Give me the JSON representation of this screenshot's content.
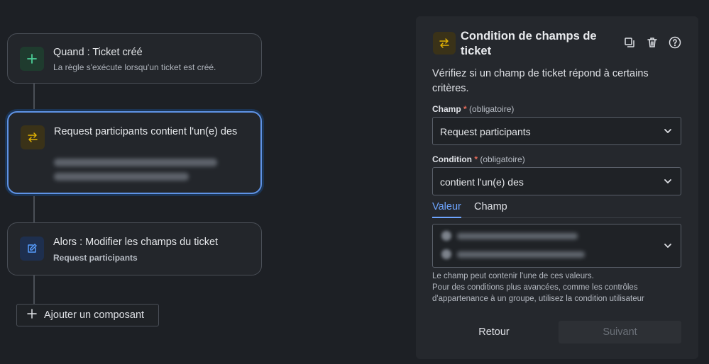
{
  "flow": {
    "trigger": {
      "title": "Quand : Ticket créé",
      "subtitle": "La règle s'exécute lorsqu'un ticket est créé.",
      "icon": "plus-icon"
    },
    "condition": {
      "title": "Request participants contient l'un(e) des",
      "icon": "swap-arrows-icon"
    },
    "action": {
      "title": "Alors : Modifier les champs du ticket",
      "subtitle": "Request participants",
      "icon": "edit-pencil-icon"
    },
    "add_component_label": "Ajouter un composant"
  },
  "panel": {
    "title": "Condition de champs de ticket",
    "icon": "swap-arrows-icon",
    "header_icons": [
      "duplicate-icon",
      "trash-icon",
      "help-icon"
    ],
    "description": "Vérifiez si un champ de ticket répond à certains critères.",
    "field": {
      "label": "Champ",
      "required_mark": "*",
      "optional_text": "(obligatoire)",
      "value": "Request participants"
    },
    "condition": {
      "label": "Condition",
      "required_mark": "*",
      "optional_text": "(obligatoire)",
      "value": "contient l'un(e) des"
    },
    "tabs": [
      {
        "label": "Valeur",
        "active": true
      },
      {
        "label": "Champ",
        "active": false
      }
    ],
    "help_lines": [
      "Le champ peut contenir l'une de ces valeurs.",
      "Pour des conditions plus avancées, comme les contrôles",
      "d'appartenance à un groupe, utilisez la condition utilisateur"
    ],
    "back_label": "Retour",
    "next_label": "Suivant"
  },
  "colors": {
    "background": "#1d2025",
    "accent_blue": "#6ea5ff",
    "trigger_green": "#4bce97",
    "condition_yellow": "#e2b203",
    "action_blue": "#579dff",
    "required_red": "#e26a5a"
  }
}
